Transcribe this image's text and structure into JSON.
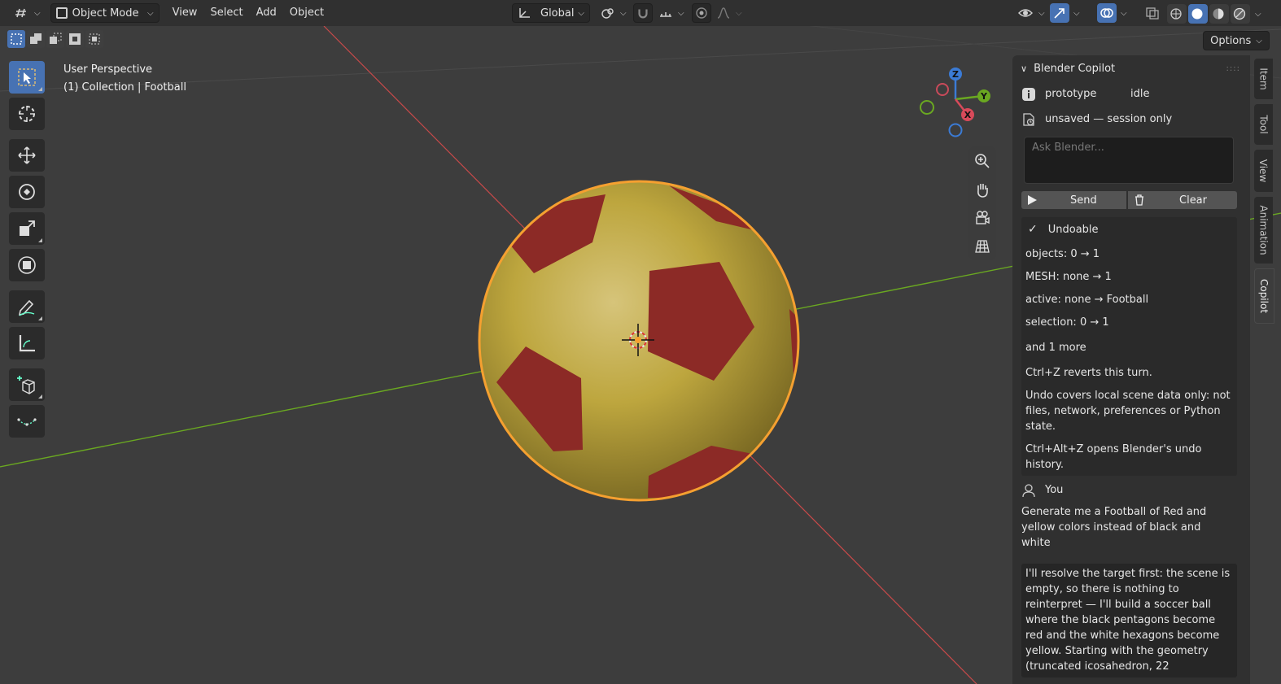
{
  "header": {
    "mode_label": "Object Mode",
    "menus": [
      "View",
      "Select",
      "Add",
      "Object"
    ],
    "orientation_label": "Global",
    "options_label": "Options"
  },
  "viewport": {
    "perspective_label": "User Perspective",
    "collection_label": "(1) Collection | Football",
    "gizmo_axes": {
      "x": "X",
      "y": "Y",
      "z": "Z"
    }
  },
  "colors": {
    "accent": "#4772b3",
    "ball_yellow": "#c9b23c",
    "ball_red": "#8c2a26",
    "selection_outline": "#f5a030",
    "axis_x": "#c94a4a",
    "axis_y": "#6aa821"
  },
  "panel": {
    "title": "Blender Copilot",
    "status_name": "prototype",
    "status_state": "idle",
    "session_label": "unsaved — session only",
    "input_placeholder": "Ask Blender...",
    "send_label": "Send",
    "clear_label": "Clear",
    "undo": {
      "title": "Undoable",
      "lines": [
        "objects: 0 → 1",
        "MESH: none → 1",
        "active: none → Football",
        "selection: 0 → 1",
        "and 1 more",
        "Ctrl+Z reverts this turn.",
        "Undo covers local scene data only: not files, network, preferences or Python state.",
        "Ctrl+Alt+Z opens Blender's undo history."
      ]
    },
    "user_label": "You",
    "user_message": "Generate me a Football of Red and yellow colors instead of black and white",
    "assistant_message": "I'll resolve the target first: the scene is empty, so there is nothing to reinterpret — I'll build a soccer ball where the black pentagons become red and the white hexagons become yellow. Starting with the geometry (truncated icosahedron, 22"
  },
  "tabs": [
    "Item",
    "Tool",
    "View",
    "Animation",
    "Copilot"
  ]
}
